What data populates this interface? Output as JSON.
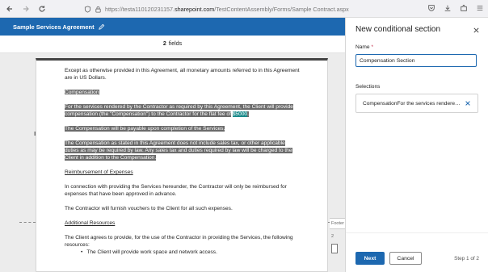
{
  "browser": {
    "url_prefix": "https://testa110120231157.",
    "url_domain": "sharepoint.com",
    "url_path": "/TestContentAssembly/Forms/Sample Contract.aspx"
  },
  "app": {
    "title": "Sample Services Agreement",
    "fields_count": "2",
    "fields_label": "fields"
  },
  "document": {
    "intro": "Except as otherwise provided in this Agreement, all monetary amounts referred to in this Agreement are in US Dollars.",
    "comp_heading": "Compensation",
    "comp_p1_a": "For the services rendered by the Contractor as required by this Agreement, the Client will provide compensation (the \"Compensation\") to the Contractor for the flat fee of",
    "comp_amount": "$5000",
    "comp_p1_end": ".",
    "comp_p2": "The Compensation will be payable upon completion of the Services.",
    "comp_p3": "The Compensation as stated in this Agreement does not include sales tax, or other applicable duties as may be required by law. Any sales tax and duties required by law will be charged to the Client in addition to the Compensation.",
    "reimb_heading": "Reimbursement of Expenses",
    "reimb_p1": "In connection with providing the Services hereunder, the Contractor will only be reimbursed for expenses that have been approved in advance.",
    "reimb_p2": "The Contractor will furnish vouchers to the Client for all such expenses.",
    "addl_heading": "Additional Resources",
    "addl_p1": "The Client agrees to provide, for the use of the Contractor in providing the Services, the following resources:",
    "addl_bullet": "The Client will provide work space and network access.",
    "footer_col_header": "Footer",
    "footer_col_value": "2"
  },
  "panel": {
    "title": "New conditional section",
    "name_label": "Name",
    "name_required": "*",
    "name_value": "Compensation Section",
    "selections_label": "Selections",
    "selection_text": "CompensationFor the services rendered by the Contractor",
    "next_label": "Next",
    "cancel_label": "Cancel",
    "step_text": "Step 1 of 2"
  },
  "colors": {
    "brand": "#1d68b0",
    "highlight": "#6b6b6b",
    "amount_highlight": "#1a8a8a"
  }
}
